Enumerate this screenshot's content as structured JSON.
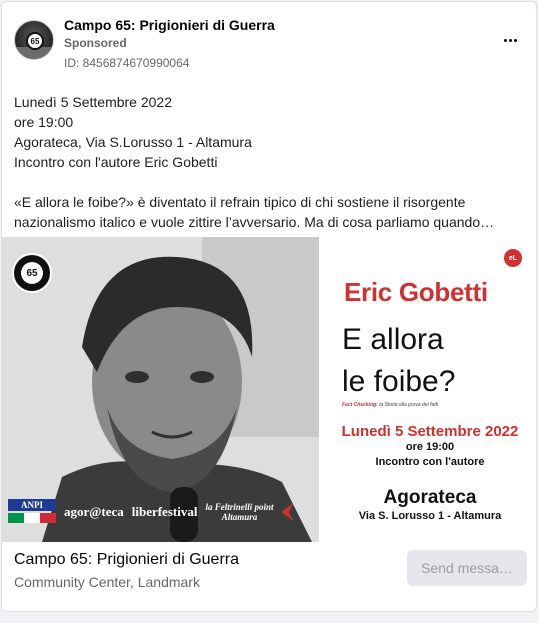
{
  "post": {
    "page_name": "Campo 65: Prigionieri di Guerra",
    "sponsored_label": "Sponsored",
    "ad_id": "ID: 8456874670990064",
    "more_icon": "more-horizontal-icon"
  },
  "body": {
    "lines_1": [
      "Lunedì 5 Settembre 2022",
      "ore 19:00",
      "Agorateca, Via S.Lorusso 1 - Altamura",
      "Incontro con l'autore Eric Gobetti"
    ],
    "lines_2": [
      "«E allora le foibe?» è diventato il refrain tipico di chi sostiene il risorgente",
      "nazionalismo italico e vuole zittire l’avversario. Ma di cosa parliamo quando…"
    ]
  },
  "creative": {
    "logo_text": "65",
    "sponsors": {
      "anpi": "ANPI",
      "agorateca": "agor@teca",
      "liberfestival": "liberfestival",
      "feltrinelli_line1": "la Feltrinelli point",
      "feltrinelli_line2": "Altamura"
    },
    "poster": {
      "author": "Eric Gobetti",
      "title_line1": "E allora",
      "title_line2": "le foibe?",
      "subtitle_prefix": "Fact Checking:",
      "subtitle_rest": " la Storia alla prova dei fatti",
      "date": "Lunedì 5 Settembre 2022",
      "time": "ore 19:00",
      "meeting": "Incontro con l'autore",
      "venue": "Agorateca",
      "address": "Via S. Lorusso 1 - Altamura"
    },
    "colors": {
      "accent_red": "#d32f2f",
      "dark": "#111111"
    }
  },
  "footer": {
    "page_name": "Campo 65: Prigionieri di Guerra",
    "category": "Community Center, Landmark",
    "send_button": "Send messa…"
  }
}
